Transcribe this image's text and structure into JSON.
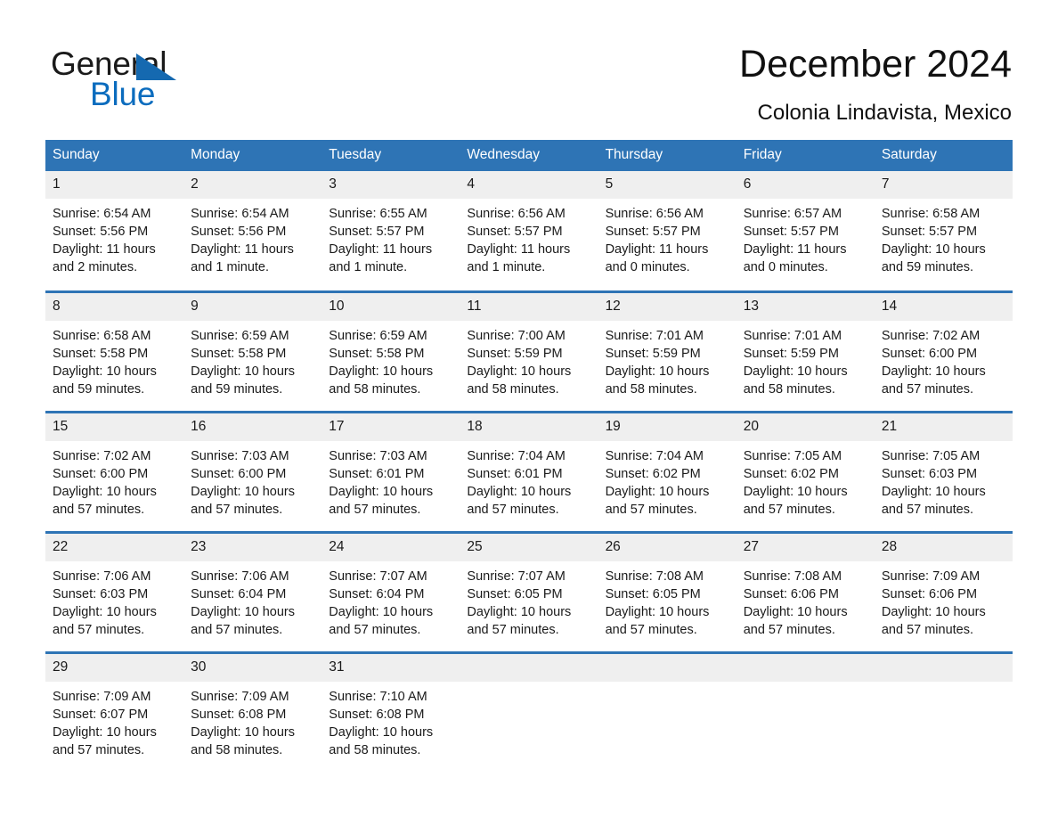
{
  "brand": {
    "word_one": "General",
    "word_two": "Blue",
    "triangle_icon": "triangle-icon",
    "colors": {
      "dark": "#1a1a1a",
      "blue": "#0b6cbe",
      "triangle": "#1569b0"
    }
  },
  "header": {
    "title": "December 2024",
    "subtitle": "Colonia Lindavista, Mexico"
  },
  "theme": {
    "header_bg": "#2e74b5",
    "header_text": "#ffffff",
    "daynum_bg": "#efefef",
    "row_divider": "#2e74b5",
    "page_bg": "#ffffff"
  },
  "calendar": {
    "weekday_headers": [
      "Sunday",
      "Monday",
      "Tuesday",
      "Wednesday",
      "Thursday",
      "Friday",
      "Saturday"
    ],
    "weeks": [
      [
        {
          "day": "1",
          "sunrise": "Sunrise: 6:54 AM",
          "sunset": "Sunset: 5:56 PM",
          "daylight_1": "Daylight: 11 hours",
          "daylight_2": "and 2 minutes."
        },
        {
          "day": "2",
          "sunrise": "Sunrise: 6:54 AM",
          "sunset": "Sunset: 5:56 PM",
          "daylight_1": "Daylight: 11 hours",
          "daylight_2": "and 1 minute."
        },
        {
          "day": "3",
          "sunrise": "Sunrise: 6:55 AM",
          "sunset": "Sunset: 5:57 PM",
          "daylight_1": "Daylight: 11 hours",
          "daylight_2": "and 1 minute."
        },
        {
          "day": "4",
          "sunrise": "Sunrise: 6:56 AM",
          "sunset": "Sunset: 5:57 PM",
          "daylight_1": "Daylight: 11 hours",
          "daylight_2": "and 1 minute."
        },
        {
          "day": "5",
          "sunrise": "Sunrise: 6:56 AM",
          "sunset": "Sunset: 5:57 PM",
          "daylight_1": "Daylight: 11 hours",
          "daylight_2": "and 0 minutes."
        },
        {
          "day": "6",
          "sunrise": "Sunrise: 6:57 AM",
          "sunset": "Sunset: 5:57 PM",
          "daylight_1": "Daylight: 11 hours",
          "daylight_2": "and 0 minutes."
        },
        {
          "day": "7",
          "sunrise": "Sunrise: 6:58 AM",
          "sunset": "Sunset: 5:57 PM",
          "daylight_1": "Daylight: 10 hours",
          "daylight_2": "and 59 minutes."
        }
      ],
      [
        {
          "day": "8",
          "sunrise": "Sunrise: 6:58 AM",
          "sunset": "Sunset: 5:58 PM",
          "daylight_1": "Daylight: 10 hours",
          "daylight_2": "and 59 minutes."
        },
        {
          "day": "9",
          "sunrise": "Sunrise: 6:59 AM",
          "sunset": "Sunset: 5:58 PM",
          "daylight_1": "Daylight: 10 hours",
          "daylight_2": "and 59 minutes."
        },
        {
          "day": "10",
          "sunrise": "Sunrise: 6:59 AM",
          "sunset": "Sunset: 5:58 PM",
          "daylight_1": "Daylight: 10 hours",
          "daylight_2": "and 58 minutes."
        },
        {
          "day": "11",
          "sunrise": "Sunrise: 7:00 AM",
          "sunset": "Sunset: 5:59 PM",
          "daylight_1": "Daylight: 10 hours",
          "daylight_2": "and 58 minutes."
        },
        {
          "day": "12",
          "sunrise": "Sunrise: 7:01 AM",
          "sunset": "Sunset: 5:59 PM",
          "daylight_1": "Daylight: 10 hours",
          "daylight_2": "and 58 minutes."
        },
        {
          "day": "13",
          "sunrise": "Sunrise: 7:01 AM",
          "sunset": "Sunset: 5:59 PM",
          "daylight_1": "Daylight: 10 hours",
          "daylight_2": "and 58 minutes."
        },
        {
          "day": "14",
          "sunrise": "Sunrise: 7:02 AM",
          "sunset": "Sunset: 6:00 PM",
          "daylight_1": "Daylight: 10 hours",
          "daylight_2": "and 57 minutes."
        }
      ],
      [
        {
          "day": "15",
          "sunrise": "Sunrise: 7:02 AM",
          "sunset": "Sunset: 6:00 PM",
          "daylight_1": "Daylight: 10 hours",
          "daylight_2": "and 57 minutes."
        },
        {
          "day": "16",
          "sunrise": "Sunrise: 7:03 AM",
          "sunset": "Sunset: 6:00 PM",
          "daylight_1": "Daylight: 10 hours",
          "daylight_2": "and 57 minutes."
        },
        {
          "day": "17",
          "sunrise": "Sunrise: 7:03 AM",
          "sunset": "Sunset: 6:01 PM",
          "daylight_1": "Daylight: 10 hours",
          "daylight_2": "and 57 minutes."
        },
        {
          "day": "18",
          "sunrise": "Sunrise: 7:04 AM",
          "sunset": "Sunset: 6:01 PM",
          "daylight_1": "Daylight: 10 hours",
          "daylight_2": "and 57 minutes."
        },
        {
          "day": "19",
          "sunrise": "Sunrise: 7:04 AM",
          "sunset": "Sunset: 6:02 PM",
          "daylight_1": "Daylight: 10 hours",
          "daylight_2": "and 57 minutes."
        },
        {
          "day": "20",
          "sunrise": "Sunrise: 7:05 AM",
          "sunset": "Sunset: 6:02 PM",
          "daylight_1": "Daylight: 10 hours",
          "daylight_2": "and 57 minutes."
        },
        {
          "day": "21",
          "sunrise": "Sunrise: 7:05 AM",
          "sunset": "Sunset: 6:03 PM",
          "daylight_1": "Daylight: 10 hours",
          "daylight_2": "and 57 minutes."
        }
      ],
      [
        {
          "day": "22",
          "sunrise": "Sunrise: 7:06 AM",
          "sunset": "Sunset: 6:03 PM",
          "daylight_1": "Daylight: 10 hours",
          "daylight_2": "and 57 minutes."
        },
        {
          "day": "23",
          "sunrise": "Sunrise: 7:06 AM",
          "sunset": "Sunset: 6:04 PM",
          "daylight_1": "Daylight: 10 hours",
          "daylight_2": "and 57 minutes."
        },
        {
          "day": "24",
          "sunrise": "Sunrise: 7:07 AM",
          "sunset": "Sunset: 6:04 PM",
          "daylight_1": "Daylight: 10 hours",
          "daylight_2": "and 57 minutes."
        },
        {
          "day": "25",
          "sunrise": "Sunrise: 7:07 AM",
          "sunset": "Sunset: 6:05 PM",
          "daylight_1": "Daylight: 10 hours",
          "daylight_2": "and 57 minutes."
        },
        {
          "day": "26",
          "sunrise": "Sunrise: 7:08 AM",
          "sunset": "Sunset: 6:05 PM",
          "daylight_1": "Daylight: 10 hours",
          "daylight_2": "and 57 minutes."
        },
        {
          "day": "27",
          "sunrise": "Sunrise: 7:08 AM",
          "sunset": "Sunset: 6:06 PM",
          "daylight_1": "Daylight: 10 hours",
          "daylight_2": "and 57 minutes."
        },
        {
          "day": "28",
          "sunrise": "Sunrise: 7:09 AM",
          "sunset": "Sunset: 6:06 PM",
          "daylight_1": "Daylight: 10 hours",
          "daylight_2": "and 57 minutes."
        }
      ],
      [
        {
          "day": "29",
          "sunrise": "Sunrise: 7:09 AM",
          "sunset": "Sunset: 6:07 PM",
          "daylight_1": "Daylight: 10 hours",
          "daylight_2": "and 57 minutes."
        },
        {
          "day": "30",
          "sunrise": "Sunrise: 7:09 AM",
          "sunset": "Sunset: 6:08 PM",
          "daylight_1": "Daylight: 10 hours",
          "daylight_2": "and 58 minutes."
        },
        {
          "day": "31",
          "sunrise": "Sunrise: 7:10 AM",
          "sunset": "Sunset: 6:08 PM",
          "daylight_1": "Daylight: 10 hours",
          "daylight_2": "and 58 minutes."
        },
        {
          "day": "",
          "sunrise": "",
          "sunset": "",
          "daylight_1": "",
          "daylight_2": ""
        },
        {
          "day": "",
          "sunrise": "",
          "sunset": "",
          "daylight_1": "",
          "daylight_2": ""
        },
        {
          "day": "",
          "sunrise": "",
          "sunset": "",
          "daylight_1": "",
          "daylight_2": ""
        },
        {
          "day": "",
          "sunrise": "",
          "sunset": "",
          "daylight_1": "",
          "daylight_2": ""
        }
      ]
    ]
  }
}
